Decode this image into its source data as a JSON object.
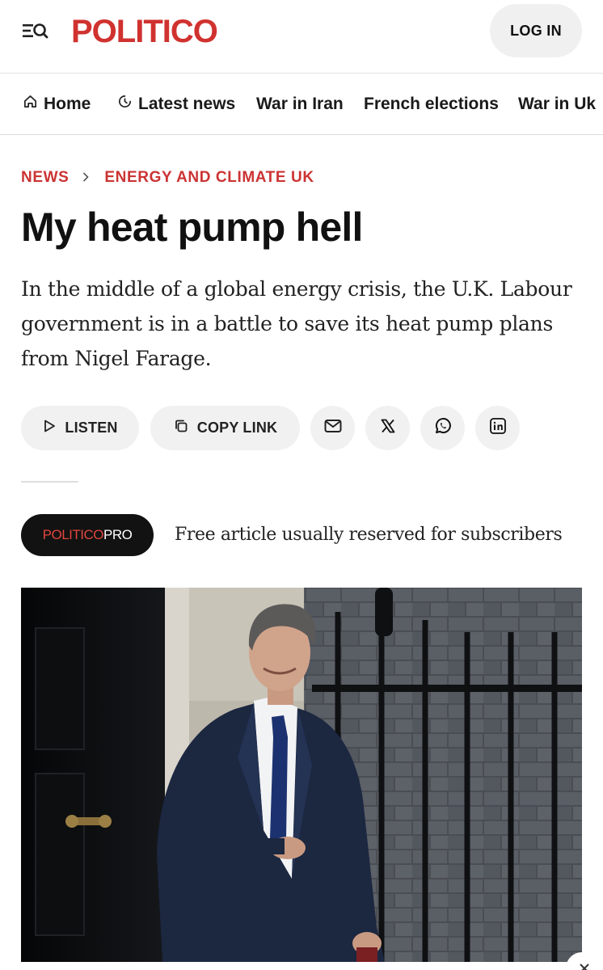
{
  "header": {
    "logo_text": "POLITICO",
    "login_label": "LOG IN",
    "menu_icon": "menu-search-icon"
  },
  "nav": {
    "items": [
      {
        "label": "Home",
        "icon": "home-icon"
      },
      {
        "label": "Latest news",
        "icon": "clock-icon"
      },
      {
        "label": "War in Iran"
      },
      {
        "label": "French elections"
      },
      {
        "label": "War in Uk"
      }
    ]
  },
  "article": {
    "breadcrumb": [
      "NEWS",
      "ENERGY AND CLIMATE UK"
    ],
    "title": "My heat pump hell",
    "dek": "In the middle of a global energy crisis, the U.K. Labour government is in a battle to save its heat pump plans from Nigel Farage.",
    "actions": {
      "listen_label": "LISTEN",
      "copy_link_label": "COPY LINK",
      "share_icons": [
        "mail-icon",
        "x-icon",
        "whatsapp-icon",
        "linkedin-icon"
      ]
    },
    "pro": {
      "badge_part1": "POLITICO",
      "badge_part2": "PRO",
      "note": "Free article usually reserved for subscribers"
    }
  },
  "colors": {
    "brand_red": "#d0322f",
    "breadcrumb_red": "#cc3333",
    "pill_bg": "#f1f1f1",
    "badge_bg": "#121212"
  }
}
